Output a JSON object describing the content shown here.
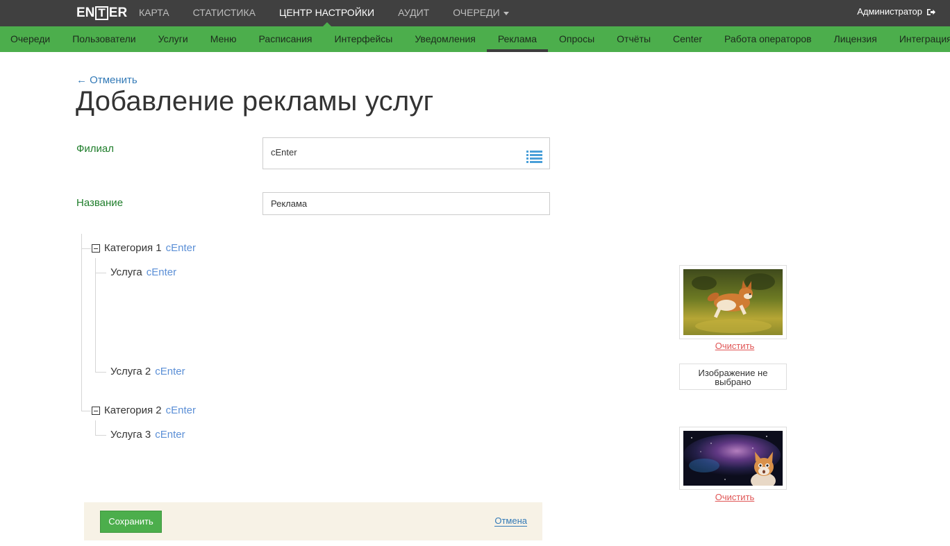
{
  "header": {
    "logo_text": "ENTER",
    "nav": [
      {
        "label": "КАРТА"
      },
      {
        "label": "СТАТИСТИКА"
      },
      {
        "label": "ЦЕНТР НАСТРОЙКИ"
      },
      {
        "label": "АУДИТ"
      },
      {
        "label": "ОЧЕРЕДИ"
      }
    ],
    "user": "Администратор"
  },
  "subnav": [
    {
      "label": "Очереди"
    },
    {
      "label": "Пользователи"
    },
    {
      "label": "Услуги"
    },
    {
      "label": "Меню"
    },
    {
      "label": "Расписания"
    },
    {
      "label": "Интерфейсы"
    },
    {
      "label": "Уведомления"
    },
    {
      "label": "Реклама"
    },
    {
      "label": "Опросы"
    },
    {
      "label": "Отчёты"
    },
    {
      "label": "Center"
    },
    {
      "label": "Работа операторов"
    },
    {
      "label": "Лицензия"
    },
    {
      "label": "Интеграция"
    }
  ],
  "page": {
    "back": "← Отменить",
    "title": "Добавление рекламы услуг"
  },
  "form": {
    "branch_label": "Филиал",
    "branch_value": "cEnter",
    "name_label": "Название",
    "name_value": "Реклама"
  },
  "tree": {
    "cat1": {
      "label": "Категория 1",
      "branch": "cEnter"
    },
    "service1": {
      "label": "Услуга",
      "branch": "cEnter"
    },
    "service2": {
      "label": "Услуга 2",
      "branch": "cEnter"
    },
    "cat2": {
      "label": "Категория 2",
      "branch": "cEnter"
    },
    "service3": {
      "label": "Услуга 3",
      "branch": "cEnter"
    }
  },
  "images": {
    "clear_label": "Очистить",
    "no_image_label": "Изображение не выбрано"
  },
  "actions": {
    "save": "Сохранить",
    "cancel": "Отмена"
  },
  "colors": {
    "topbar": "#404040",
    "green": "#4cae4c",
    "link": "#337ab7",
    "label_green": "#1e7d2a",
    "clear_red": "#e05555"
  }
}
